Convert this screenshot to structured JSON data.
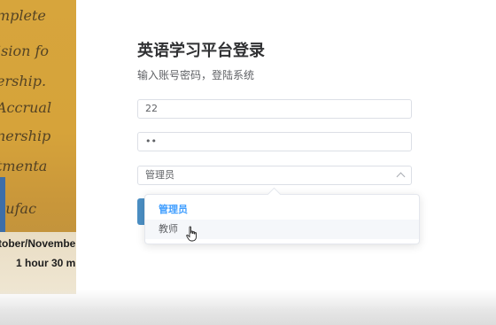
{
  "background": {
    "handwriting": [
      "mplete",
      "ision fo",
      "ership.",
      "Accrual",
      "nership",
      "tmenta",
      "nufac"
    ],
    "paper_lines": [
      "tober/November",
      "1 hour 30 m"
    ]
  },
  "form": {
    "title": "英语学习平台登录",
    "subtitle": "输入账号密码，登陆系统",
    "username_value": "22",
    "password_value": "••",
    "role_selected": "管理员"
  },
  "dropdown": {
    "options": [
      {
        "label": "管理员",
        "state": "selected"
      },
      {
        "label": "教师",
        "state": "hover"
      }
    ]
  },
  "colors": {
    "accent": "#409eff",
    "button": "#4b8fc4"
  },
  "icons": {
    "select_caret": "chevron-up-icon",
    "cursor": "hand-pointer-icon"
  }
}
